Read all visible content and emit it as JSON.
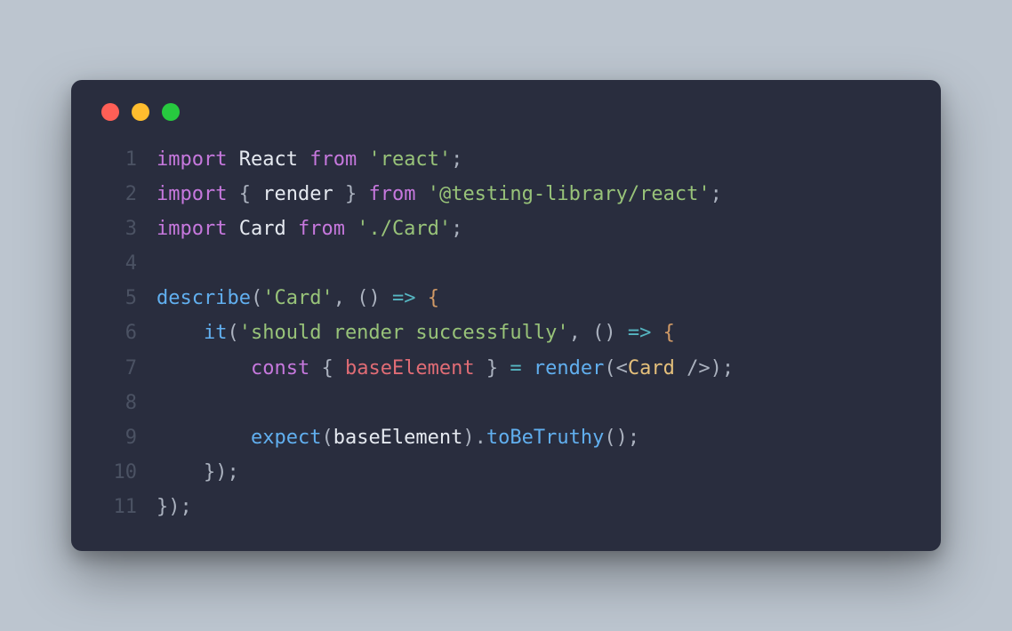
{
  "window_controls": [
    "close",
    "minimize",
    "zoom"
  ],
  "code_lines": [
    {
      "n": 1,
      "tokens": [
        {
          "t": "import",
          "c": "kw"
        },
        {
          "t": " ",
          "c": "pun"
        },
        {
          "t": "React",
          "c": "id"
        },
        {
          "t": " ",
          "c": "pun"
        },
        {
          "t": "from",
          "c": "kw"
        },
        {
          "t": " ",
          "c": "pun"
        },
        {
          "t": "'react'",
          "c": "str"
        },
        {
          "t": ";",
          "c": "pun"
        }
      ]
    },
    {
      "n": 2,
      "tokens": [
        {
          "t": "import",
          "c": "kw"
        },
        {
          "t": " { ",
          "c": "pun"
        },
        {
          "t": "render",
          "c": "id"
        },
        {
          "t": " } ",
          "c": "pun"
        },
        {
          "t": "from",
          "c": "kw"
        },
        {
          "t": " ",
          "c": "pun"
        },
        {
          "t": "'@testing-library/react'",
          "c": "str"
        },
        {
          "t": ";",
          "c": "pun"
        }
      ]
    },
    {
      "n": 3,
      "tokens": [
        {
          "t": "import",
          "c": "kw"
        },
        {
          "t": " ",
          "c": "pun"
        },
        {
          "t": "Card",
          "c": "id"
        },
        {
          "t": " ",
          "c": "pun"
        },
        {
          "t": "from",
          "c": "kw"
        },
        {
          "t": " ",
          "c": "pun"
        },
        {
          "t": "'./Card'",
          "c": "str"
        },
        {
          "t": ";",
          "c": "pun"
        }
      ]
    },
    {
      "n": 4,
      "tokens": []
    },
    {
      "n": 5,
      "tokens": [
        {
          "t": "describe",
          "c": "fn"
        },
        {
          "t": "(",
          "c": "pun"
        },
        {
          "t": "'Card'",
          "c": "str"
        },
        {
          "t": ", ",
          "c": "pun"
        },
        {
          "t": "()",
          "c": "pun"
        },
        {
          "t": " ",
          "c": "pun"
        },
        {
          "t": "=>",
          "c": "op"
        },
        {
          "t": " ",
          "c": "pun"
        },
        {
          "t": "{",
          "c": "par"
        }
      ]
    },
    {
      "n": 6,
      "tokens": [
        {
          "t": "    ",
          "c": "pun"
        },
        {
          "t": "it",
          "c": "fn"
        },
        {
          "t": "(",
          "c": "pun"
        },
        {
          "t": "'should render successfully'",
          "c": "str"
        },
        {
          "t": ", ",
          "c": "pun"
        },
        {
          "t": "()",
          "c": "pun"
        },
        {
          "t": " ",
          "c": "pun"
        },
        {
          "t": "=>",
          "c": "op"
        },
        {
          "t": " ",
          "c": "pun"
        },
        {
          "t": "{",
          "c": "par"
        }
      ]
    },
    {
      "n": 7,
      "tokens": [
        {
          "t": "        ",
          "c": "pun"
        },
        {
          "t": "const",
          "c": "kw"
        },
        {
          "t": " { ",
          "c": "pun"
        },
        {
          "t": "baseElement",
          "c": "var"
        },
        {
          "t": " } ",
          "c": "pun"
        },
        {
          "t": "=",
          "c": "op"
        },
        {
          "t": " ",
          "c": "pun"
        },
        {
          "t": "render",
          "c": "fn"
        },
        {
          "t": "(",
          "c": "pun"
        },
        {
          "t": "<",
          "c": "pun"
        },
        {
          "t": "Card",
          "c": "tag"
        },
        {
          "t": " />",
          "c": "pun"
        },
        {
          "t": ");",
          "c": "pun"
        }
      ]
    },
    {
      "n": 8,
      "tokens": []
    },
    {
      "n": 9,
      "tokens": [
        {
          "t": "        ",
          "c": "pun"
        },
        {
          "t": "expect",
          "c": "fn"
        },
        {
          "t": "(",
          "c": "pun"
        },
        {
          "t": "baseElement",
          "c": "id"
        },
        {
          "t": ").",
          "c": "pun"
        },
        {
          "t": "toBeTruthy",
          "c": "fn"
        },
        {
          "t": "();",
          "c": "pun"
        }
      ]
    },
    {
      "n": 10,
      "tokens": [
        {
          "t": "    ",
          "c": "pun"
        },
        {
          "t": "});",
          "c": "pun"
        }
      ]
    },
    {
      "n": 11,
      "tokens": [
        {
          "t": "});",
          "c": "pun"
        }
      ]
    }
  ]
}
